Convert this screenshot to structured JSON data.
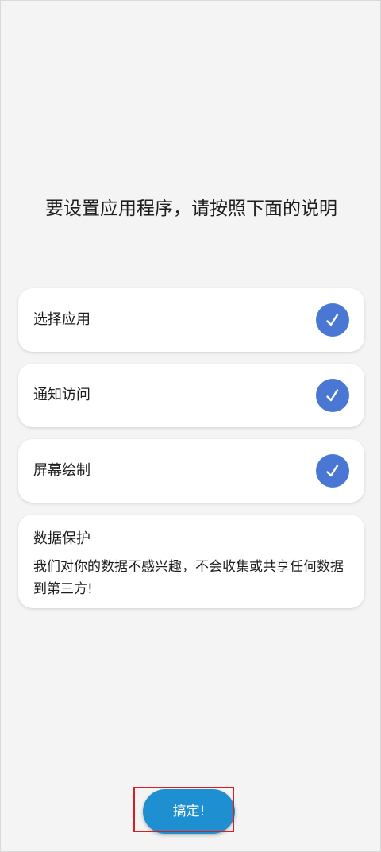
{
  "header": {
    "title": "要设置应用程序，请按照下面的说明"
  },
  "steps": [
    {
      "label": "选择应用",
      "completed": true,
      "icon": "check-icon"
    },
    {
      "label": "通知访问",
      "completed": true,
      "icon": "check-icon"
    },
    {
      "label": "屏幕绘制",
      "completed": true,
      "icon": "check-icon"
    }
  ],
  "privacy": {
    "title": "数据保护",
    "text": "我们对你的数据不感兴趣，不会收集或共享任何数据到第三方!"
  },
  "footer": {
    "done_label": "搞定!"
  },
  "colors": {
    "background": "#f4f4f4",
    "card": "#ffffff",
    "check_accent": "#4a76d4",
    "button_primary": "#1e8fd0",
    "highlight_outline": "#d81e1e"
  }
}
